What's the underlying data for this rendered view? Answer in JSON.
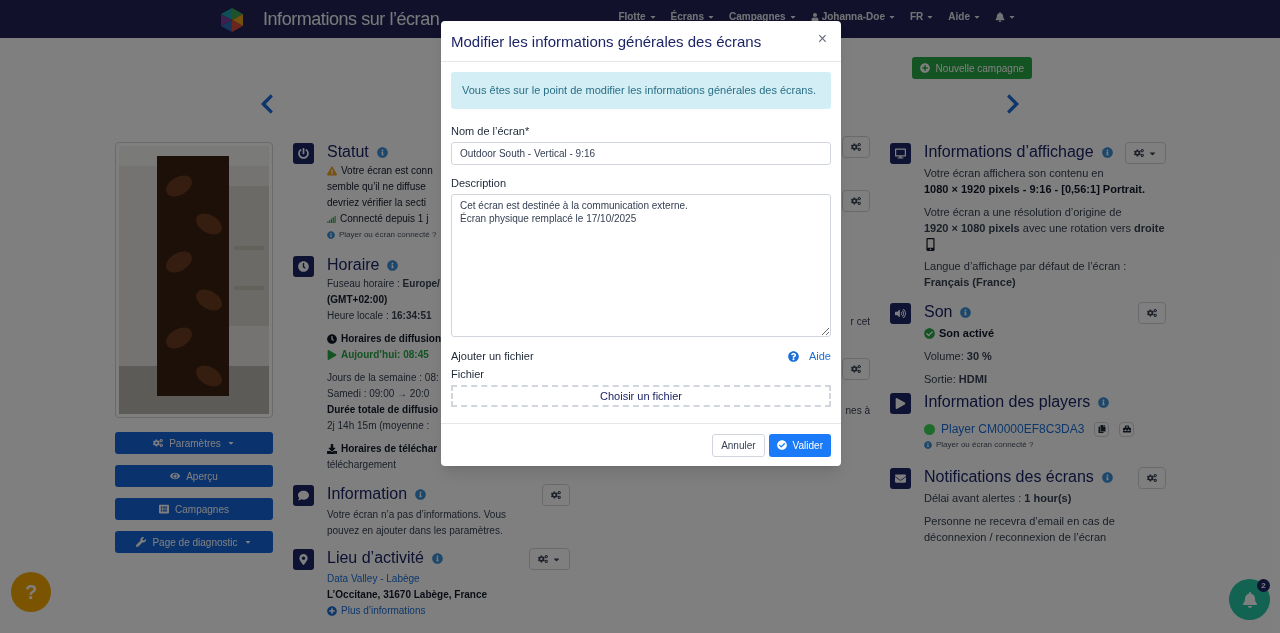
{
  "navbar": {
    "title": "Informations sur l’écran",
    "menus": [
      {
        "kind": "dropdown",
        "label": "Flotte"
      },
      {
        "kind": "dropdown",
        "label": "Écrans"
      },
      {
        "kind": "dropdown",
        "label": "Campagnes"
      },
      {
        "kind": "user",
        "label": "Johanna-Doe"
      },
      {
        "kind": "dropdown",
        "label": "FR"
      },
      {
        "kind": "dropdown",
        "label": "Aide"
      },
      {
        "kind": "bell"
      }
    ]
  },
  "new_campaign_button": "Nouvelle campagne",
  "left_panel": {
    "buttons": [
      {
        "kind": "settings",
        "label": "Paramètres",
        "dropdown": true
      },
      {
        "kind": "preview",
        "label": "Aperçu",
        "dropdown": false
      },
      {
        "kind": "campaigns",
        "label": "Campagnes",
        "dropdown": false
      },
      {
        "kind": "diagnostic",
        "label": "Page de diagnostic",
        "dropdown": true
      }
    ]
  },
  "main_sections": [
    {
      "kind": "status",
      "title": "Statut",
      "lines": [
        {
          "kind": "warning",
          "text": "Votre écran est conn"
        },
        {
          "kind": "dark",
          "text": "semble qu’il ne diffuse"
        },
        {
          "kind": "dark",
          "text": "devriez vérifier la secti"
        },
        {
          "kind": "signal",
          "text": "Connecté depuis 1 j"
        },
        {
          "kind": "hint",
          "text": "Player ou écran connecté ?"
        }
      ]
    },
    {
      "kind": "schedule",
      "title": "Horaire",
      "lines": [
        {
          "kind": "text",
          "text": "Fuseau horaire : **Europe/**"
        },
        {
          "kind": "strong",
          "text": "(GMT+02:00)"
        },
        {
          "kind": "text",
          "text": "Heure locale : **16:34:51**"
        },
        {
          "kind": "clock",
          "text": "Horaires de diffusion",
          "gap_before": true
        },
        {
          "kind": "play",
          "text": "Aujourd’hui: 08:45"
        },
        {
          "kind": "text",
          "text": "Jours de la semaine : 08:",
          "gap_before": true
        },
        {
          "kind": "text",
          "text": "Samedi : 09:00 → 20:0"
        },
        {
          "kind": "strong",
          "text": "Durée totale de diffusio"
        },
        {
          "kind": "text",
          "text": "2j 14h 15m (moyenne :"
        },
        {
          "kind": "download",
          "text": "Horaires de téléchar",
          "gap_before": true
        },
        {
          "kind": "text",
          "text": "téléchargement"
        }
      ]
    },
    {
      "kind": "information",
      "title": "Information",
      "settings_dropdown": false,
      "lines": [
        {
          "kind": "text",
          "text": "Votre écran n’a pas d’informations. Vous"
        },
        {
          "kind": "text",
          "text": "pouvez en ajouter dans les paramètres."
        }
      ]
    },
    {
      "kind": "location",
      "title": "Lieu d’activité",
      "settings_dropdown": true,
      "lines": [
        {
          "kind": "link",
          "text": "Data Valley - Labège"
        },
        {
          "kind": "strong",
          "text": "L’Occitane, 31670 Labège, France"
        },
        {
          "kind": "plus-link",
          "text": "Plus d’informations"
        }
      ]
    }
  ],
  "side_fragments": [
    {
      "kind": "gear"
    },
    {
      "kind": "gear"
    },
    {
      "kind": "text",
      "text": "r cet"
    },
    {
      "kind": "gear"
    },
    {
      "kind": "text",
      "text": "nes à"
    }
  ],
  "right_sections": [
    {
      "kind": "display",
      "title": "Informations d’affichage",
      "settings_dropdown": true,
      "paragraphs": [
        [
          {
            "kind": "text",
            "text": "Votre écran affichera son contenu en"
          },
          {
            "kind": "strong",
            "text": "1080 × 1920 pixels - 9:16 - [0,56:1] Portrait."
          }
        ],
        [
          {
            "kind": "text",
            "text": "Votre écran a une résolution d’origine de"
          },
          {
            "kind": "text",
            "text": "**1920  × 1080 pixels** avec une rotation vers **droite**"
          },
          {
            "kind": "rotation"
          }
        ],
        [
          {
            "kind": "text",
            "text": "Langue d’affichage par défaut de l’écran : **Français (France)**"
          }
        ]
      ]
    },
    {
      "kind": "sound",
      "title": "Son",
      "settings_dropdown": false,
      "paragraphs": [
        [
          {
            "kind": "check",
            "text": "Son activé"
          }
        ],
        [
          {
            "kind": "text",
            "text": "Volume: **30 %**"
          }
        ],
        [
          {
            "kind": "text",
            "text": "Sortie: **HDMI**"
          }
        ]
      ]
    },
    {
      "kind": "players",
      "title": "Information des players",
      "paragraphs": [
        [
          {
            "kind": "player",
            "text": "Player CM0000EF8C3DA3",
            "color": "#1f6b2b"
          },
          {
            "kind": "hint",
            "text": "Player ou écran connecté ?"
          }
        ]
      ]
    },
    {
      "kind": "notifications",
      "title": "Notifications des écrans",
      "settings_dropdown": false,
      "paragraphs": [
        [
          {
            "kind": "text",
            "text": "Délai avant alertes : **1 hour(s)**"
          }
        ],
        [
          {
            "kind": "text",
            "text": "Personne ne recevra d’email en cas de déconnexion / reconnexion de l’écran"
          }
        ]
      ]
    }
  ],
  "modal": {
    "title": "Modifier les informations générales des écrans",
    "close": "×",
    "alert": "Vous êtes sur le point de modifier les informations générales des écrans.",
    "fields": [
      {
        "kind": "input",
        "label": "Nom de l’écran*",
        "value": "Outdoor South - Vertical - 9:16"
      },
      {
        "kind": "textarea",
        "label": "Description",
        "value": "Cet écran est destinée à la communication externe.\nÉcran physique remplacé le 17/10/2025"
      }
    ],
    "file": {
      "section_label": "Ajouter un fichier",
      "help": "Aide",
      "label": "Fichier",
      "button": "Choisir un fichier"
    },
    "buttons": [
      {
        "kind": "secondary",
        "label": "Annuler"
      },
      {
        "kind": "primary",
        "label": "Valider"
      }
    ]
  },
  "help_button": "?",
  "notifications_badge": "2"
}
